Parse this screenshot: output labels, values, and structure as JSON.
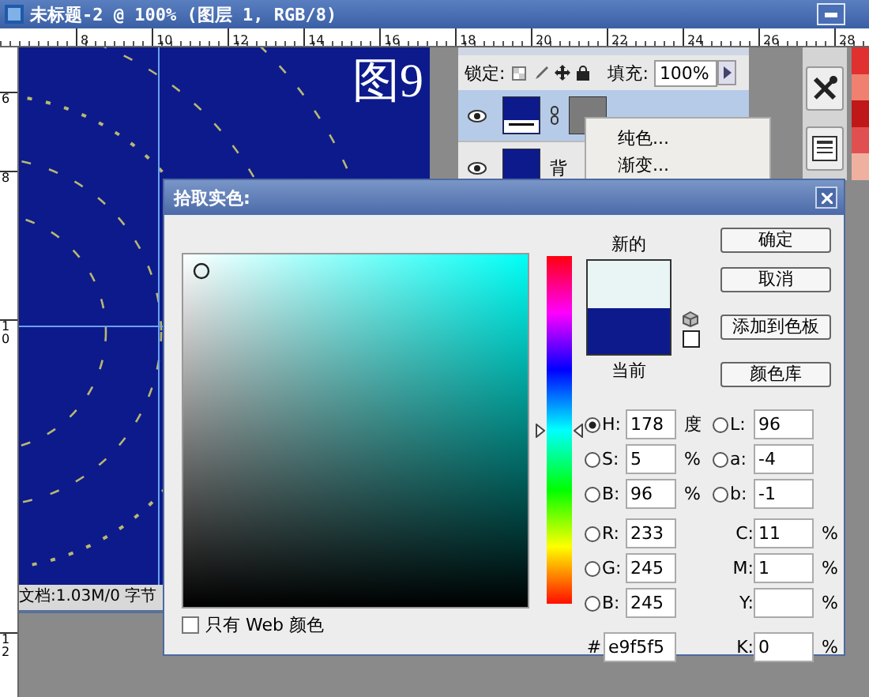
{
  "window": {
    "title": "未标题-2 @ 100% (图层 1, RGB/8)"
  },
  "top_ruler": [
    "8",
    "10",
    "12",
    "14",
    "16",
    "18",
    "20",
    "22",
    "24",
    "26",
    "28"
  ],
  "left_ruler": [
    "6",
    "8",
    "10",
    "12"
  ],
  "canvas": {
    "caption": "图9"
  },
  "status_bar": {
    "doc_info": "文档:1.03M/0 字节"
  },
  "layers_panel": {
    "lock_label": "锁定:",
    "fill_label": "填充:",
    "fill_value": "100%",
    "layers": [
      {
        "kind": "masked",
        "selected": true
      },
      {
        "kind": "plain",
        "name": "背",
        "selected": false
      }
    ]
  },
  "context_menu": {
    "items": [
      "纯色...",
      "渐变..."
    ]
  },
  "dialog": {
    "title": "拾取实色:",
    "hue_slider": {
      "level": 0.494
    },
    "swatches": [
      {
        "label": "新的",
        "color": "#e9f5f5"
      },
      {
        "label": "当前",
        "color": "#0d1a8c"
      }
    ],
    "buttons": [
      "确定",
      "取消",
      "添加到色板",
      "颜色库"
    ],
    "hsb": [
      {
        "label": "H:",
        "value": "178",
        "unit": "度",
        "selected": true
      },
      {
        "label": "S:",
        "value": "5",
        "unit": "%",
        "selected": false
      },
      {
        "label": "B:",
        "value": "96",
        "unit": "%",
        "selected": false
      }
    ],
    "rgb": [
      {
        "label": "R:",
        "value": "233",
        "selected": false
      },
      {
        "label": "G:",
        "value": "245",
        "selected": false
      },
      {
        "label": "B:",
        "value": "245",
        "selected": false
      }
    ],
    "hex": {
      "label": "#",
      "value": "e9f5f5"
    },
    "lab": [
      {
        "label": "L:",
        "value": "96",
        "selected": false
      },
      {
        "label": "a:",
        "value": "-4",
        "selected": false
      },
      {
        "label": "b:",
        "value": "-1",
        "selected": false
      }
    ],
    "cmyk": [
      {
        "label": "C:",
        "value": "11",
        "unit": "%"
      },
      {
        "label": "M:",
        "value": "1",
        "unit": "%"
      },
      {
        "label": "Y:",
        "unit": "%"
      },
      {
        "label": "K:",
        "value": "0",
        "unit": "%"
      }
    ],
    "web_only": {
      "label": "只有 Web 颜色",
      "checked": false
    }
  }
}
